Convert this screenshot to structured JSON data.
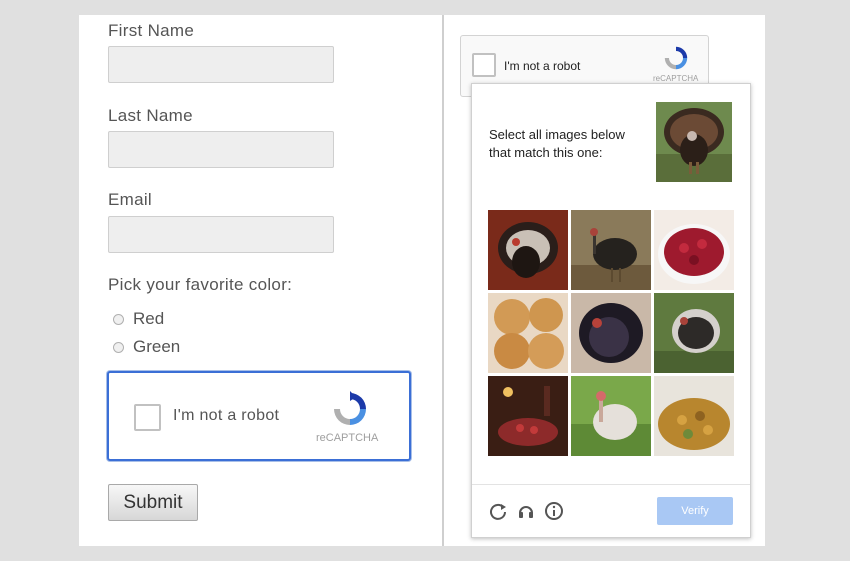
{
  "form": {
    "first_name_label": "First Name",
    "last_name_label": "Last Name",
    "email_label": "Email",
    "color_prompt": "Pick your favorite color:",
    "color_options": [
      "Red",
      "Green"
    ],
    "submit_label": "Submit"
  },
  "recaptcha": {
    "checkbox_label": "I'm not a robot",
    "brand": "reCAPTCHA",
    "accent_color": "#3b6fd6"
  },
  "challenge": {
    "instruction": "Select all images below that match this one:",
    "verify_label": "Verify",
    "tiles": [
      "turkey",
      "turkey",
      "cranberry sauce",
      "bread rolls",
      "turkey",
      "turkey",
      "cranberry dish",
      "turkey",
      "stuffing"
    ],
    "footer_icons": [
      "reload-icon",
      "audio-icon",
      "info-icon"
    ],
    "verify_color": "#a9c8f4"
  }
}
